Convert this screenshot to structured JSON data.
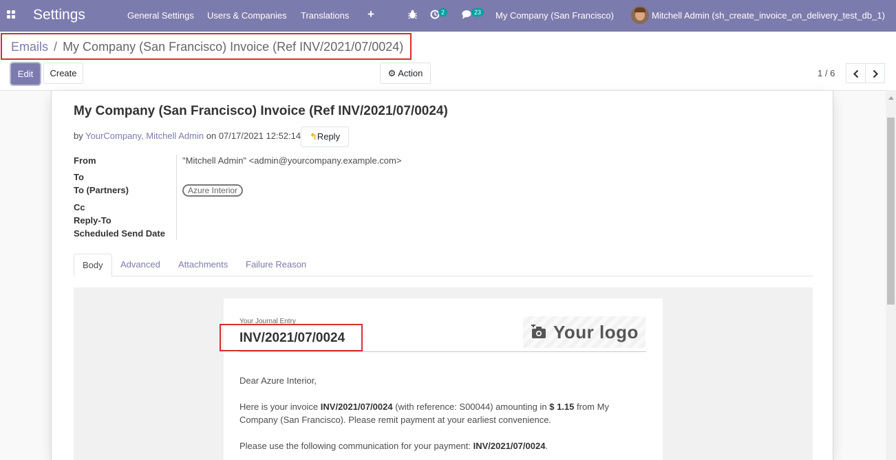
{
  "navbar": {
    "app_title": "Settings",
    "menu": [
      "General Settings",
      "Users & Companies",
      "Translations"
    ],
    "add_label": "+",
    "activity_count": "2",
    "messages_count": "23",
    "company": "My Company (San Francisco)",
    "user": "Mitchell Admin (sh_create_invoice_on_delivery_test_db_1)"
  },
  "breadcrumb": {
    "parent": "Emails",
    "separator": "/",
    "current": "My Company (San Francisco) Invoice (Ref INV/2021/07/0024)"
  },
  "toolbar": {
    "edit_label": "Edit",
    "create_label": "Create",
    "action_label": "Action",
    "pager": "1 / 6"
  },
  "message": {
    "subject": "My Company (San Francisco) Invoice (Ref INV/2021/07/0024)",
    "by": "by",
    "author": "YourCompany, Mitchell Admin",
    "on": "on",
    "date": "07/17/2021 12:52:14",
    "reply_label": "Reply"
  },
  "fields": {
    "from_label": "From",
    "from_value": "\"Mitchell Admin\" <admin@yourcompany.example.com>",
    "to_label": "To",
    "to_partners_label": "To (Partners)",
    "to_partners_tag": "Azure Interior",
    "cc_label": "Cc",
    "reply_to_label": "Reply-To",
    "scheduled_label": "Scheduled Send Date"
  },
  "tabs": [
    "Body",
    "Advanced",
    "Attachments",
    "Failure Reason"
  ],
  "email_body": {
    "journal_caption": "Your Journal Entry",
    "journal_number": "INV/2021/07/0024",
    "logo_text": "Your logo",
    "greeting": "Dear Azure Interior,",
    "p1_a": "Here is your invoice ",
    "p1_invoice": "INV/2021/07/0024",
    "p1_b": " (with reference: S00044) amounting in ",
    "p1_amount": "$ 1.15",
    "p1_c": " from My Company (San Francisco). Please remit payment at your earliest convenience.",
    "p2_a": "Please use the following communication for your payment: ",
    "p2_ref": "INV/2021/07/0024",
    "p2_b": "."
  },
  "colors": {
    "brand": "#7c7bad",
    "highlight": "#d32f2f",
    "badge": "#00a09d"
  }
}
